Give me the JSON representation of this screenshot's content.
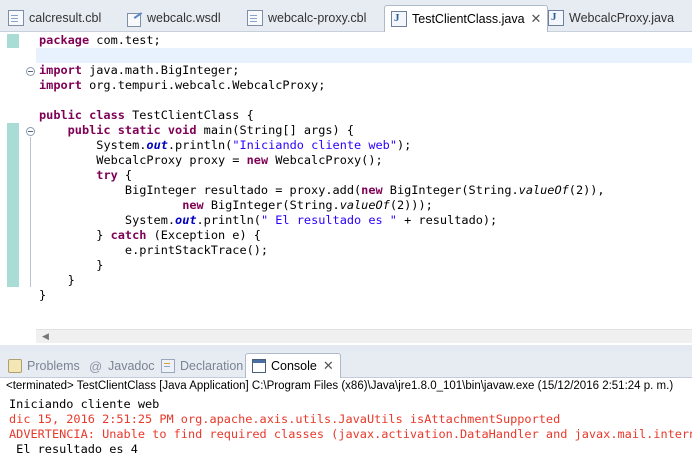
{
  "editor_tabs": [
    {
      "label": "calcresult.cbl",
      "icon": "file-icon"
    },
    {
      "label": "webcalc.wsdl",
      "icon": "wsdl-file-icon"
    },
    {
      "label": "webcalc-proxy.cbl",
      "icon": "file-icon"
    },
    {
      "label": "TestClientClass.java",
      "icon": "java-file-icon",
      "active": true,
      "close": "✕"
    },
    {
      "label": "WebcalcProxy.java",
      "icon": "java-file-icon"
    }
  ],
  "code": {
    "l1": {
      "kw": "package",
      "rest": " com.test;"
    },
    "l3": {
      "kw": "import",
      "rest": " java.math.BigInteger;"
    },
    "l4": {
      "kw": "import",
      "rest": " org.tempuri.webcalc.WebcalcProxy;"
    },
    "l6": {
      "kw": "public class",
      "rest": " TestClientClass {"
    },
    "l7": {
      "indent": "    ",
      "kw": "public static void",
      "rest": " main(String[] args) {"
    },
    "l8": {
      "indent": "        ",
      "a": "System.",
      "fld": "out",
      "b": ".println(",
      "str": "\"Iniciando cliente web\"",
      "c": ");"
    },
    "l9": {
      "indent": "        ",
      "a": "WebcalcProxy proxy = ",
      "kw": "new",
      "b": " WebcalcProxy();"
    },
    "l10": {
      "indent": "        ",
      "kw": "try",
      "rest": " {"
    },
    "l11": {
      "indent": "            ",
      "a": "BigInteger resultado = proxy.add(",
      "kw": "new",
      "b": " BigInteger(String.",
      "it": "valueOf",
      "c": "(2)),"
    },
    "l12": {
      "indent": "                    ",
      "kw": "new",
      "b": " BigInteger(String.",
      "it": "valueOf",
      "c": "(2)));"
    },
    "l13": {
      "indent": "            ",
      "a": "System.",
      "fld": "out",
      "b": ".println(",
      "str": "\" El resultado es \"",
      "c": " + resultado);"
    },
    "l14": {
      "indent": "        ",
      "a": "} ",
      "kw": "catch",
      "b": " (Exception e) {"
    },
    "l15": {
      "indent": "            ",
      "a": "e.printStackTrace();"
    },
    "l16": {
      "indent": "        ",
      "a": "}"
    },
    "l17": {
      "indent": "    ",
      "a": "}"
    },
    "l18": {
      "a": "}"
    }
  },
  "panel_tabs": [
    {
      "label": "Problems",
      "icon": "problems-icon"
    },
    {
      "label": "Javadoc",
      "icon": "at-icon",
      "glyph": "@"
    },
    {
      "label": "Declaration",
      "icon": "declaration-icon"
    },
    {
      "label": "Console",
      "icon": "console-icon",
      "active": true,
      "close": "✕"
    }
  ],
  "console": {
    "terminated": "<terminated> TestClientClass [Java Application] C:\\Program Files (x86)\\Java\\jre1.8.0_101\\bin\\javaw.exe (15/12/2016 2:51:24 p. m.)",
    "lines": [
      {
        "text": "Iniciando cliente web",
        "type": "out"
      },
      {
        "text": "dic 15, 2016 2:51:25 PM org.apache.axis.utils.JavaUtils isAttachmentSupported",
        "type": "err"
      },
      {
        "text": "ADVERTENCIA: Unable to find required classes (javax.activation.DataHandler and javax.mail.internet",
        "type": "err"
      },
      {
        "text": " El resultado es 4",
        "type": "out"
      }
    ]
  },
  "colors": {
    "keyword": "#7f0055",
    "string": "#2a00ff",
    "field": "#0000c0",
    "stderr": "#e8392b",
    "change_bar": "#a9dcd5",
    "current_line": "#e8f2fe"
  }
}
